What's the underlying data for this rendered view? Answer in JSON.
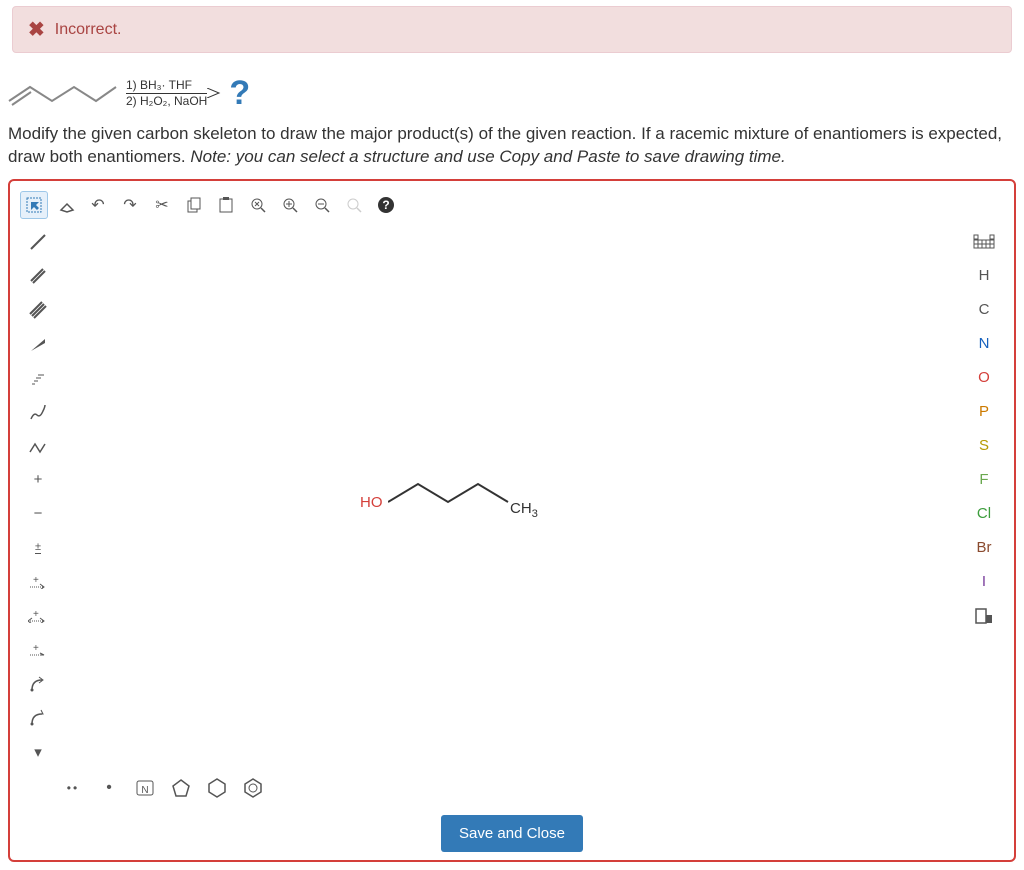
{
  "alert": {
    "status": "Incorrect."
  },
  "reaction": {
    "line1": "1) BH₃· THF",
    "line2": "2) H₂O₂, NaOH",
    "product_placeholder": "?"
  },
  "prompt": {
    "main": "Modify the given carbon skeleton to draw the major product(s) of the given reaction. If a racemic mixture of enantiomers is expected, draw both enantiomers. ",
    "note_label": "Note: ",
    "note_text": "you can select a structure and use Copy and Paste to save drawing time."
  },
  "molecule": {
    "left_label": "HO",
    "right_label": "CH₃"
  },
  "buttons": {
    "save": "Save and Close"
  },
  "right_elements": [
    "H",
    "C",
    "N",
    "O",
    "P",
    "S",
    "F",
    "Cl",
    "Br",
    "I"
  ]
}
